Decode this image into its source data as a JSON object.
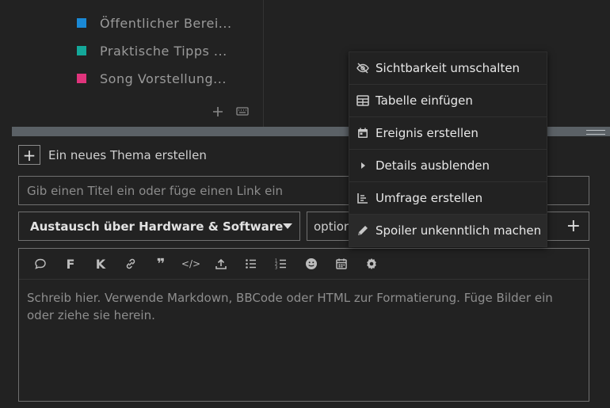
{
  "sidebar": {
    "categories": [
      {
        "label": "Öffentlicher Berei...",
        "color": "#1a89d6"
      },
      {
        "label": "Praktische Tipps ...",
        "color": "#14a89a"
      },
      {
        "label": "Song Vorstellung...",
        "color": "#e0347c"
      }
    ],
    "tools": {
      "add_icon": "plus-icon",
      "keyboard_icon": "keyboard-icon"
    }
  },
  "composer": {
    "new_topic_label": "Ein neues Thema erstellen",
    "title_placeholder": "Gib einen Titel ein oder füge einen Link ein",
    "category": {
      "label": "Austausch über Hardware & Software",
      "color": "#9b2f9b"
    },
    "tags_label": "optior",
    "editor_placeholder": "Schreib hier. Verwende Markdown, BBCode oder HTML zur Formatierung. Füge Bilder ein oder ziehe sie herein.",
    "toolbar": [
      {
        "name": "quote-icon"
      },
      {
        "name": "bold-icon",
        "glyph": "F"
      },
      {
        "name": "italic-icon",
        "glyph": "K"
      },
      {
        "name": "link-icon"
      },
      {
        "name": "blockquote-icon",
        "glyph": "❞"
      },
      {
        "name": "code-icon",
        "glyph": "</>"
      },
      {
        "name": "upload-icon"
      },
      {
        "name": "bullet-list-icon"
      },
      {
        "name": "numbered-list-icon"
      },
      {
        "name": "emoji-icon"
      },
      {
        "name": "calendar-icon"
      },
      {
        "name": "gear-icon"
      }
    ]
  },
  "menu": {
    "items": [
      {
        "label": "Sichtbarkeit umschalten",
        "icon": "eye-slash-icon"
      },
      {
        "label": "Tabelle einfügen",
        "icon": "table-icon"
      },
      {
        "label": "Ereignis erstellen",
        "icon": "calendar-icon"
      },
      {
        "label": "Details ausblenden",
        "icon": "caret-right-icon"
      },
      {
        "label": "Umfrage erstellen",
        "icon": "chart-icon"
      },
      {
        "label": "Spoiler unkenntlich machen",
        "icon": "pencil-icon"
      }
    ]
  }
}
